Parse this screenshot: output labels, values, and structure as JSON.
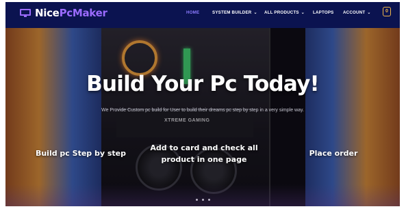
{
  "brand": {
    "name_part1": "Nice",
    "name_part2": "PcMaker"
  },
  "nav": {
    "items": [
      {
        "label": "HOME",
        "active": true,
        "dropdown": false
      },
      {
        "label": "SYSTEM BUILDER",
        "active": false,
        "dropdown": true
      },
      {
        "label": "ALL PRODUCTS",
        "active": false,
        "dropdown": true
      },
      {
        "label": "LAPTOPS",
        "active": false,
        "dropdown": false
      },
      {
        "label": "ACCOUNT",
        "active": false,
        "dropdown": true
      }
    ],
    "cart_count": "0"
  },
  "hero": {
    "title": "Build Your Pc Today!",
    "subtitle": "We Provide Custom pc build for User to build their dreams pc step by step in a very simple way.",
    "steps": [
      {
        "label": "Build pc Step by step"
      },
      {
        "label_line1": "Add to card and check all",
        "label_line2": "product in one page"
      },
      {
        "label": "Place order"
      }
    ],
    "gpu_text": "XTREME GAMING"
  },
  "colors": {
    "nav_bg": "#0b1350",
    "accent": "#8d7bff",
    "cart": "#f2b84b",
    "brand_secondary": "#9b6bff"
  },
  "icons": {
    "logo": "monitor-icon",
    "cart": "shopping-bag-icon",
    "caret": "chevron-down-icon"
  }
}
